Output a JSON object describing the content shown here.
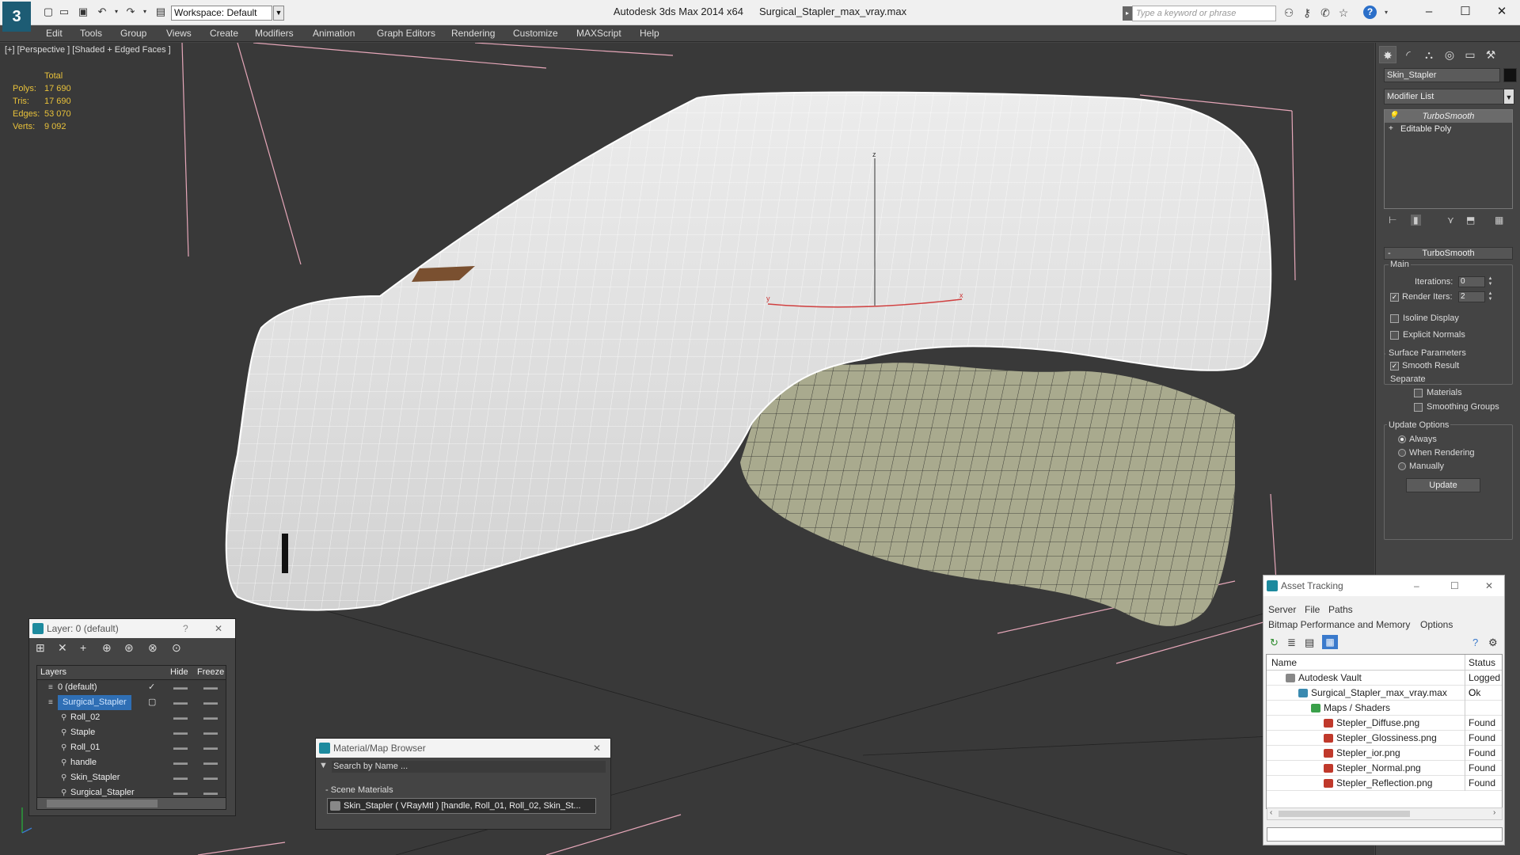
{
  "app": {
    "name": "Autodesk 3ds Max  2014 x64",
    "file": "Surgical_Stapler_max_vray.max",
    "logo": "3ds-max-logo",
    "workspace": "Workspace: Default",
    "search_placeholder": "Type a keyword or phrase"
  },
  "menu": [
    "Edit",
    "Tools",
    "Group",
    "Views",
    "Create",
    "Modifiers",
    "Animation",
    "Graph Editors",
    "Rendering",
    "Customize",
    "MAXScript",
    "Help"
  ],
  "viewport": {
    "label": "[+] [Perspective ] [Shaded + Edged Faces ]",
    "stats": {
      "header": "Total",
      "rows": [
        {
          "k": "Polys:",
          "v": "17 690"
        },
        {
          "k": "Tris:",
          "v": "17 690"
        },
        {
          "k": "Edges:",
          "v": "53 070"
        },
        {
          "k": "Verts:",
          "v": "9 092"
        }
      ]
    },
    "gizmo": {
      "z": "z",
      "x": "x",
      "y": "y"
    },
    "colors": {
      "bg": "#393939",
      "mesh": "#e4e4e4",
      "wire": "#ffffff",
      "handle": "#a9aa8e",
      "grid": "#e6a7b9",
      "stats": "#e8c13a"
    }
  },
  "command_panel": {
    "object_name": "Skin_Stapler",
    "modifier_list": "Modifier List",
    "stack": [
      {
        "label": "TurboSmooth",
        "selected": true
      },
      {
        "label": "Editable Poly",
        "selected": false
      }
    ],
    "rollout_title": "TurboSmooth",
    "main_label": "Main",
    "iterations_label": "Iterations:",
    "iterations_value": "0",
    "render_iters_label": "Render Iters:",
    "render_iters_value": "2",
    "isoline_label": "Isoline Display",
    "explicit_label": "Explicit Normals",
    "surface_label": "Surface Parameters",
    "smooth_label": "Smooth Result",
    "separate_label": "Separate",
    "materials_label": "Materials",
    "smoothing_label": "Smoothing Groups",
    "update_options_label": "Update Options",
    "always_label": "Always",
    "when_rendering_label": "When Rendering",
    "manually_label": "Manually",
    "update_button": "Update"
  },
  "layer_panel": {
    "title": "Layer: 0 (default)",
    "help": "?",
    "columns": {
      "layers": "Layers",
      "hide": "Hide",
      "freeze": "Freeze"
    },
    "rows": [
      {
        "name": "0 (default)",
        "level": 1,
        "selected": false,
        "active": true
      },
      {
        "name": "Surgical_Stapler",
        "level": 1,
        "selected": true,
        "active": false
      },
      {
        "name": "Roll_02",
        "level": 2,
        "selected": false,
        "active": false
      },
      {
        "name": "Staple",
        "level": 2,
        "selected": false,
        "active": false
      },
      {
        "name": "Roll_01",
        "level": 2,
        "selected": false,
        "active": false
      },
      {
        "name": "handle",
        "level": 2,
        "selected": false,
        "active": false
      },
      {
        "name": "Skin_Stapler",
        "level": 2,
        "selected": false,
        "active": false
      },
      {
        "name": "Surgical_Stapler",
        "level": 2,
        "selected": false,
        "active": false
      }
    ]
  },
  "material_panel": {
    "title": "Material/Map Browser",
    "search_placeholder": "Search by Name ...",
    "section": "Scene Materials",
    "item": "Skin_Stapler  ( VRayMtl ) [handle, Roll_01, Roll_02, Skin_St..."
  },
  "asset_panel": {
    "title": "Asset Tracking",
    "menu": [
      "Server",
      "File",
      "Paths"
    ],
    "menu2": [
      "Bitmap Performance and Memory",
      "Options"
    ],
    "columns": {
      "name": "Name",
      "status": "Status"
    },
    "rows": [
      {
        "name": "Autodesk Vault",
        "status": "Logged O",
        "level": 1,
        "icon": "vault-icon"
      },
      {
        "name": "Surgical_Stapler_max_vray.max",
        "status": "Ok",
        "level": 2,
        "icon": "max-file-icon"
      },
      {
        "name": "Maps / Shaders",
        "status": "",
        "level": 3,
        "icon": "maps-icon"
      },
      {
        "name": "Stepler_Diffuse.png",
        "status": "Found",
        "level": 4,
        "icon": "png-icon"
      },
      {
        "name": "Stepler_Glossiness.png",
        "status": "Found",
        "level": 4,
        "icon": "png-icon"
      },
      {
        "name": "Stepler_ior.png",
        "status": "Found",
        "level": 4,
        "icon": "png-icon"
      },
      {
        "name": "Stepler_Normal.png",
        "status": "Found",
        "level": 4,
        "icon": "png-icon"
      },
      {
        "name": "Stepler_Reflection.png",
        "status": "Found",
        "level": 4,
        "icon": "png-icon"
      }
    ]
  }
}
